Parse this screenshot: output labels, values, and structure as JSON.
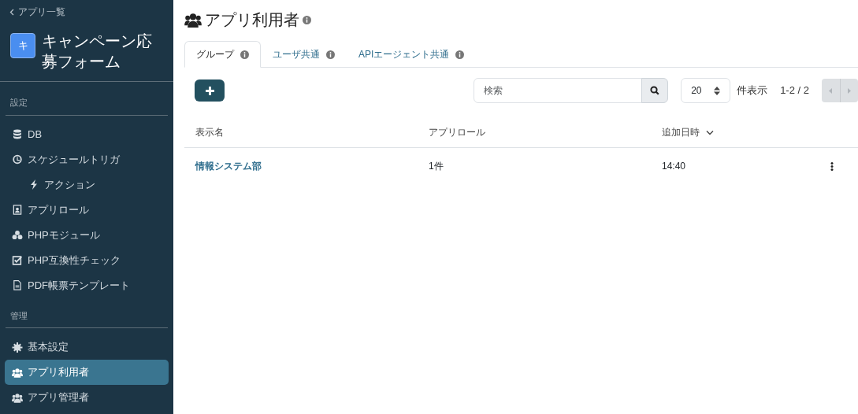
{
  "back_link": "アプリ一覧",
  "app": {
    "initial": "キ",
    "name": "キャンペーン応募フォーム"
  },
  "sidebar": {
    "sections": [
      {
        "title": "設定",
        "items": [
          {
            "label": "DB",
            "selected": false
          },
          {
            "label": "スケジュールトリガ",
            "selected": false,
            "children": [
              {
                "label": "アクション",
                "selected": false
              }
            ]
          },
          {
            "label": "アプリロール",
            "selected": false
          },
          {
            "label": "PHPモジュール",
            "selected": false
          },
          {
            "label": "PHP互換性チェック",
            "selected": false
          },
          {
            "label": "PDF帳票テンプレート",
            "selected": false
          }
        ]
      },
      {
        "title": "管理",
        "items": [
          {
            "label": "基本設定",
            "selected": false
          },
          {
            "label": "アプリ利用者",
            "selected": true
          },
          {
            "label": "アプリ管理者",
            "selected": false
          }
        ]
      }
    ]
  },
  "page_title": "アプリ利用者",
  "tabs": [
    {
      "label": "グループ",
      "selected": true
    },
    {
      "label": "ユーザ共通",
      "selected": false
    },
    {
      "label": "APIエージェント共通",
      "selected": false
    }
  ],
  "search": {
    "placeholder": "検索"
  },
  "page_size": "20",
  "page_size_label": "件表示",
  "range": "1-2 / 2",
  "pager": {
    "disabled": true
  },
  "table": {
    "columns": [
      {
        "label": "表示名",
        "sorted": false
      },
      {
        "label": "アプリロール",
        "sorted": false
      },
      {
        "label": "追加日時",
        "sorted": true
      }
    ],
    "rows": [
      {
        "cells": [
          "情報システム部",
          "1件",
          "14:40"
        ]
      }
    ]
  }
}
